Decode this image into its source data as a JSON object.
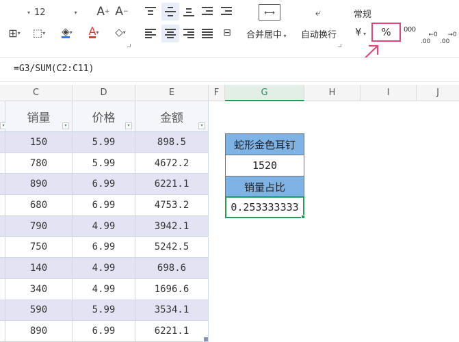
{
  "toolbar": {
    "font_size": "12",
    "increase_font": "A⁺",
    "decrease_font": "A⁻",
    "merge_center_label": "合并居中",
    "wrap_text_label": "自动换行",
    "number_format_label": "常规",
    "currency_symbol": "¥",
    "percent_symbol": "%",
    "thousands_symbol": "000",
    "decimal_increase_symbol": "←0\n.00",
    "decimal_decrease_symbol": "→0\n.00",
    "accent_color": "#e0457b",
    "font_color_underline": "#e53935",
    "fill_color_underline": "#2b7de9"
  },
  "formula_bar": {
    "formula": "=G3/SUM(C2:C11)"
  },
  "columns": [
    "C",
    "D",
    "E",
    "F",
    "G",
    "H",
    "I",
    "J"
  ],
  "selected_column": "G",
  "table": {
    "headers": [
      "销量",
      "价格",
      "金额"
    ],
    "rows": [
      [
        "150",
        "5.99",
        "898.5"
      ],
      [
        "780",
        "5.99",
        "4672.2"
      ],
      [
        "890",
        "6.99",
        "6221.1"
      ],
      [
        "680",
        "6.99",
        "4753.2"
      ],
      [
        "790",
        "4.99",
        "3942.1"
      ],
      [
        "750",
        "6.99",
        "5242.5"
      ],
      [
        "140",
        "4.99",
        "698.6"
      ],
      [
        "340",
        "4.99",
        "1696.6"
      ],
      [
        "590",
        "5.99",
        "3534.1"
      ],
      [
        "890",
        "6.99",
        "6221.1"
      ]
    ]
  },
  "side_block": {
    "product_name": "蛇形金色耳钉",
    "product_sales": "1520",
    "ratio_label": "销量占比",
    "ratio_value": "0.253333333"
  },
  "colors": {
    "header_blue": "#7fb3e6",
    "row_alt": "#e3e3f3",
    "selection_green": "#1f9d55"
  }
}
